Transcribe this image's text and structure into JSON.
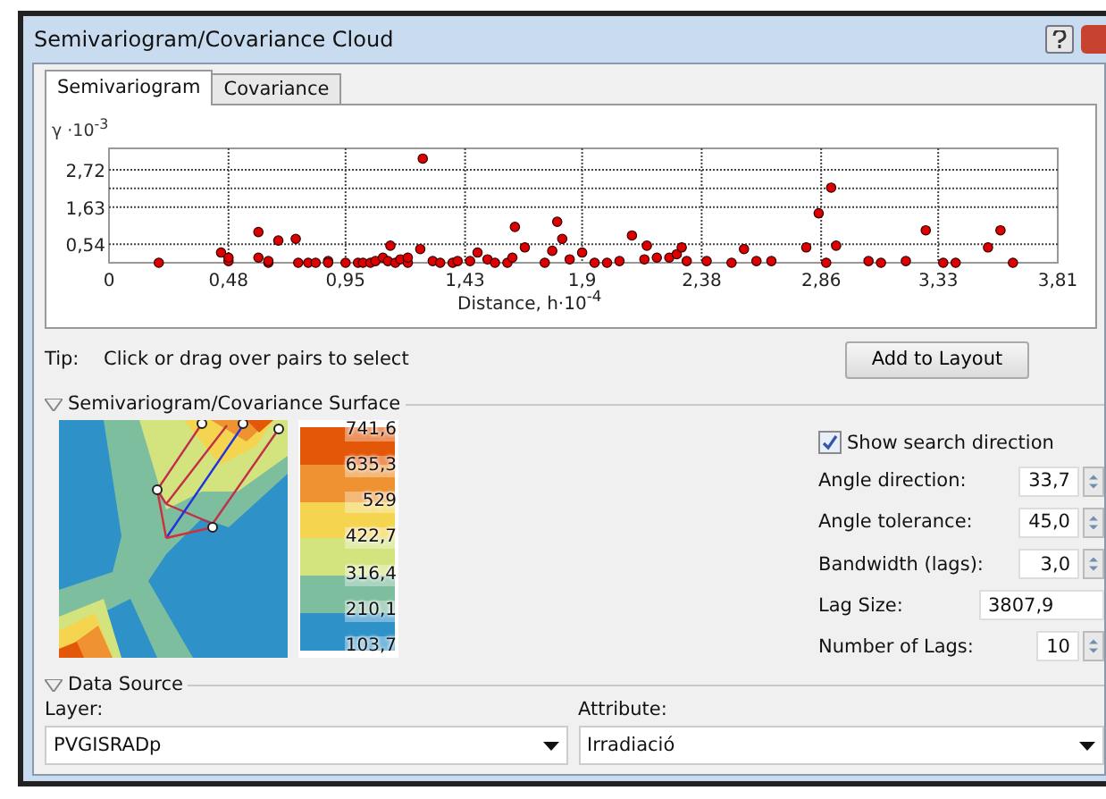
{
  "window": {
    "title": "Semivariogram/Covariance Cloud"
  },
  "tabs": [
    {
      "label": "Semivariogram",
      "selected": true
    },
    {
      "label": "Covariance",
      "selected": false
    }
  ],
  "chart_data": {
    "type": "scatter",
    "grid": true,
    "xlabel": "Distance, h·10$^{-4}$",
    "ylabel": "γ ·10$^{-3}$",
    "xlim": [
      0,
      3.81
    ],
    "ylim": [
      0,
      3.35
    ],
    "xticks": [
      {
        "value": 0,
        "label": "0"
      },
      {
        "value": 0.48,
        "label": "0,48"
      },
      {
        "value": 0.95,
        "label": "0,95"
      },
      {
        "value": 1.43,
        "label": "1,43"
      },
      {
        "value": 1.9,
        "label": "1,9"
      },
      {
        "value": 2.38,
        "label": "2,38"
      },
      {
        "value": 2.86,
        "label": "2,86"
      },
      {
        "value": 3.33,
        "label": "3,33"
      },
      {
        "value": 3.81,
        "label": "3,81"
      }
    ],
    "yticks": [
      {
        "value": 0.54,
        "label": "0,54"
      },
      {
        "value": 1.63,
        "label": "1,63"
      },
      {
        "value": 2.72,
        "label": "2,72"
      }
    ],
    "series": [
      {
        "color": "#dd0000",
        "x": [
          0.2,
          0.45,
          0.48,
          0.48,
          0.6,
          0.6,
          0.64,
          0.64,
          0.68,
          0.75,
          0.76,
          0.8,
          0.83,
          0.88,
          0.88,
          0.95,
          1.0,
          1.02,
          1.05,
          1.07,
          1.1,
          1.12,
          1.13,
          1.15,
          1.17,
          1.2,
          1.2,
          1.25,
          1.3,
          1.33,
          1.26,
          1.38,
          1.4,
          1.45,
          1.48,
          1.52,
          1.55,
          1.6,
          1.62,
          1.63,
          1.67,
          1.75,
          1.78,
          1.8,
          1.82,
          1.85,
          1.9,
          1.95,
          2.0,
          2.05,
          2.1,
          2.15,
          2.16,
          2.2,
          2.25,
          2.28,
          2.3,
          2.32,
          2.4,
          2.5,
          2.55,
          2.6,
          2.66,
          2.8,
          2.85,
          2.88,
          2.9,
          2.92,
          3.05,
          3.1,
          3.2,
          3.28,
          3.35,
          3.4,
          3.53,
          3.58,
          3.63
        ],
        "values": [
          0,
          0.3,
          0.05,
          0.15,
          0.9,
          0.15,
          0,
          0.05,
          0.65,
          0.7,
          0,
          0,
          0,
          0.05,
          0,
          0,
          0,
          0,
          0,
          0.05,
          0.15,
          0.05,
          0.5,
          0,
          0.1,
          0,
          0.15,
          0.4,
          0.05,
          0,
          3.05,
          0,
          0.05,
          0.05,
          0.3,
          0.1,
          0,
          0,
          0.15,
          1.05,
          0.45,
          0,
          0.35,
          1.2,
          0.7,
          0.1,
          0.3,
          0,
          0,
          0.05,
          0.8,
          0.1,
          0.5,
          0.15,
          0.15,
          0.25,
          0.45,
          0.05,
          0.05,
          0,
          0.4,
          0.05,
          0.05,
          0.45,
          1.45,
          0,
          2.2,
          0.5,
          0.05,
          0,
          0.05,
          0.95,
          0,
          0,
          0.45,
          0.95,
          0
        ]
      }
    ]
  },
  "tip": {
    "label": "Tip:",
    "text": "Click or drag over pairs to select"
  },
  "add_button": "Add to Layout",
  "surface": {
    "title": "Semivariogram/Covariance Surface",
    "expanded": true,
    "legend_labels": [
      "741,6",
      "635,3",
      "529",
      "422,7",
      "316,4",
      "210,1",
      "103,7"
    ],
    "legend_bands": [
      {
        "color": "#e35808"
      },
      {
        "color": "#ee9232"
      },
      {
        "color": "#f5d550"
      },
      {
        "color": "#d3e37e"
      },
      {
        "color": "#7dbe9f"
      },
      {
        "color": "#2e92c9"
      }
    ],
    "show_direction": {
      "label": "Show search direction",
      "checked": true
    },
    "params": [
      {
        "kind": "spinner",
        "label": "Angle direction:",
        "value": "33,7"
      },
      {
        "kind": "spinner",
        "label": "Angle tolerance:",
        "value": "45,0"
      },
      {
        "kind": "spinner",
        "label": "Bandwidth (lags):",
        "value": "3,0"
      },
      {
        "kind": "text",
        "label": "Lag Size:",
        "value": "3807,9"
      },
      {
        "kind": "spinner",
        "label": "Number of Lags:",
        "value": "10"
      }
    ]
  },
  "data_source": {
    "title": "Data Source",
    "expanded": true,
    "layer": {
      "label": "Layer:",
      "value": "PVGISRADp"
    },
    "attribute": {
      "label": "Attribute:",
      "value": "Irradiació"
    }
  }
}
